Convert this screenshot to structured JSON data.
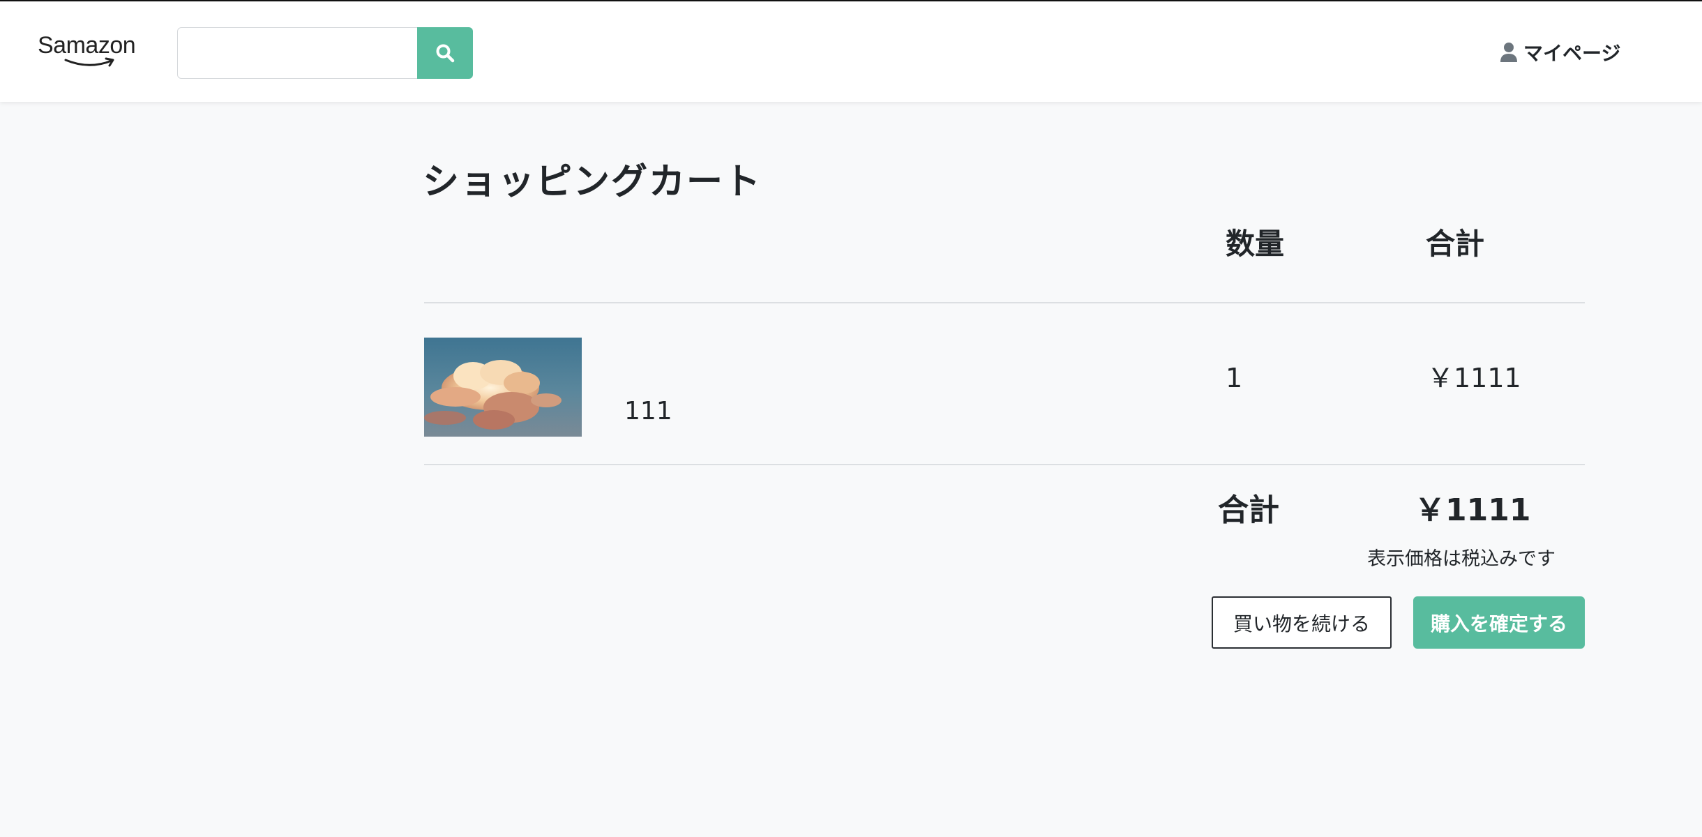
{
  "header": {
    "logo_text": "Samazon",
    "search_placeholder": "",
    "search_icon": "search-icon",
    "mypage_icon": "user-icon",
    "mypage_label": "マイページ"
  },
  "cart": {
    "title": "ショッピングカート",
    "columns": {
      "quantity": "数量",
      "subtotal": "合計"
    },
    "items": [
      {
        "name": "111",
        "quantity": "1",
        "price": "￥1111",
        "image": "cloud-photo"
      }
    ],
    "total_label": "合計",
    "total_value": "￥1111",
    "tax_note": "表示価格は税込みです",
    "continue_label": "買い物を続ける",
    "confirm_label": "購入を確定する"
  },
  "colors": {
    "accent": "#58bc9e",
    "background": "#f8f9fa",
    "text": "#212529"
  }
}
